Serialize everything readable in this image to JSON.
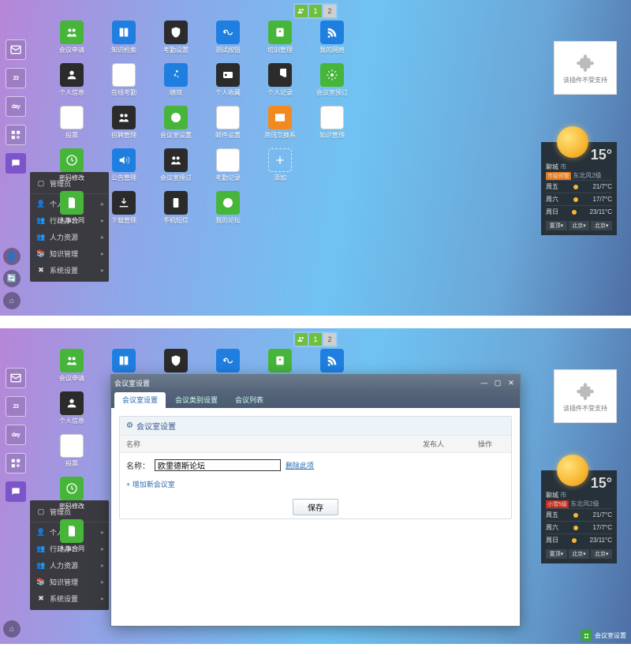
{
  "pager": {
    "pages": [
      "",
      "1",
      "2"
    ]
  },
  "rail": [
    {
      "name": "mail-icon",
      "glyph": "mail"
    },
    {
      "name": "calendar-icon",
      "glyph": "cal",
      "text": "23"
    },
    {
      "name": "day-icon",
      "glyph": "txt",
      "text": "day"
    },
    {
      "name": "add-tile-icon",
      "glyph": "plus"
    },
    {
      "name": "chat-icon",
      "glyph": "chat",
      "cls": "purple"
    }
  ],
  "start_menu": [
    {
      "icon": "square",
      "label": "管理员",
      "arrow": false
    },
    {
      "icon": "user",
      "label": "个人办公",
      "arrow": true
    },
    {
      "icon": "group",
      "label": "行政办公",
      "arrow": true
    },
    {
      "icon": "group",
      "label": "人力资源",
      "arrow": true
    },
    {
      "icon": "book",
      "label": "知识管理",
      "arrow": true
    },
    {
      "icon": "wrench",
      "label": "系统设置",
      "arrow": true
    }
  ],
  "apps": [
    [
      {
        "c": "c-green",
        "lbl": "会议申请",
        "g": "people"
      },
      {
        "c": "c-blue",
        "lbl": "知识检索",
        "g": "book"
      },
      {
        "c": "c-dark",
        "lbl": "考勤设置",
        "g": "shield"
      },
      {
        "c": "c-blue",
        "lbl": "测试按钮",
        "g": "wave"
      },
      {
        "c": "c-green",
        "lbl": "培训管理",
        "g": "badge"
      },
      {
        "c": "c-blue",
        "lbl": "我的网络",
        "g": "rss"
      }
    ],
    [
      {
        "c": "c-dark",
        "lbl": "个人信息",
        "g": "user"
      },
      {
        "c": "c-white",
        "lbl": "在线考勤",
        "g": "clock"
      },
      {
        "c": "c-blue",
        "lbl": "绩效",
        "g": "run"
      },
      {
        "c": "c-dark",
        "lbl": "个人收藏",
        "g": "card"
      },
      {
        "c": "c-dark",
        "lbl": "个人记录",
        "g": "pie"
      },
      {
        "c": "c-green",
        "lbl": "会议室预订",
        "g": "gear"
      }
    ],
    [
      {
        "c": "c-white",
        "lbl": "投票",
        "g": "chat"
      },
      {
        "c": "c-dark",
        "lbl": "招聘管理",
        "g": "people"
      },
      {
        "c": "c-green",
        "lbl": "会议室设置",
        "g": "xbox"
      },
      {
        "c": "c-white",
        "lbl": "邮件设置",
        "g": "mail"
      },
      {
        "c": "c-orange",
        "lbl": "资讯交换系",
        "g": "mail"
      },
      {
        "c": "c-white",
        "lbl": "知识管理",
        "g": "mailb"
      }
    ],
    [
      {
        "c": "c-green",
        "lbl": "密码修改",
        "g": "clock"
      },
      {
        "c": "c-blue",
        "lbl": "公告管理",
        "g": "sound"
      },
      {
        "c": "c-dark",
        "lbl": "会议室预订",
        "g": "people"
      },
      {
        "c": "c-white",
        "lbl": "考勤记录",
        "g": "list"
      },
      {
        "c": "c-dashed",
        "lbl": "添加",
        "g": "plus"
      }
    ],
    [
      {
        "c": "c-green",
        "lbl": "人事合同",
        "g": "doc"
      },
      {
        "c": "c-dark",
        "lbl": "下载管理",
        "g": "down"
      },
      {
        "c": "c-dark",
        "lbl": "手机短信",
        "g": "phone"
      },
      {
        "c": "c-green",
        "lbl": "我的论坛",
        "g": "xbox"
      }
    ]
  ],
  "plugin_widget": {
    "text": "该插件不受支持"
  },
  "weather": {
    "city": "聊城",
    "city_suffix": "市",
    "temp": "15°",
    "badge1": "市级预警",
    "badge2": "小雪5级",
    "wind": "东北风2级",
    "days": [
      {
        "d": "周五",
        "t": "21/7°C"
      },
      {
        "d": "周六",
        "t": "17/7°C"
      },
      {
        "d": "周日",
        "t": "23/11°C"
      }
    ],
    "selects": [
      "置顶▾",
      "北京▾",
      "北京▾"
    ]
  },
  "window": {
    "title": "会议室设置",
    "tabs": [
      "会议室设置",
      "会议类别设置",
      "会议列表"
    ],
    "section_title": "会议室设置",
    "cols": [
      "名称",
      "发布人",
      "操作"
    ],
    "name_label": "名称：",
    "name_value": "欧里德斯论坛",
    "delete_link": "删除此项",
    "add_link": "+ 增加新会议室",
    "save": "保存"
  },
  "taskbar_label": "会议室设置"
}
